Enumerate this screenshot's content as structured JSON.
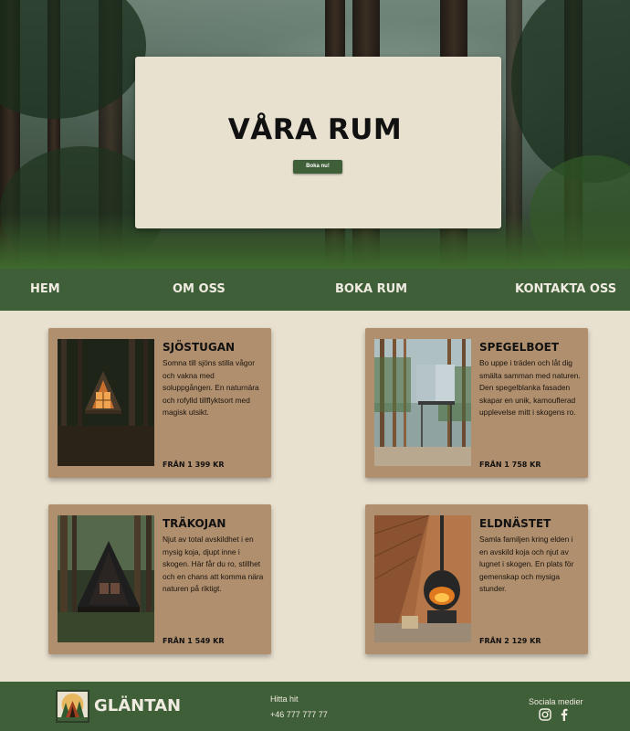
{
  "hero": {
    "title": "VÅRA RUM",
    "book_button": "Boka nu!"
  },
  "nav": {
    "items": [
      {
        "label": "HEM"
      },
      {
        "label": "OM OSS"
      },
      {
        "label": "BOKA RUM"
      },
      {
        "label": "KONTAKTA OSS"
      }
    ]
  },
  "rooms": [
    {
      "name": "SJÖSTUGAN",
      "description": "Somna till sjöns stilla vågor och vakna med soluppgången. En naturnära och rofylld tillflyktsort med magisk utsikt.",
      "price": "FRÅN 1 399 KR",
      "image": "a-frame-cabin-photo"
    },
    {
      "name": "SPEGELBOET",
      "description": "Bo uppe i träden och låt dig smälta samman med naturen. Den spegelblanka fasaden skapar en unik, kamouflerad upplevelse mitt i skogens ro.",
      "price": "FRÅN 1 758 KR",
      "image": "mirror-treehouse-photo"
    },
    {
      "name": "TRÄKOJAN",
      "description": "Njut av total avskildhet i en mysig koja, djupt inne i skogen. Här får du ro, stillhet och en chans att komma nära naturen på riktigt.",
      "price": "FRÅN 1 549 KR",
      "image": "dark-a-frame-cabin-photo"
    },
    {
      "name": "ELDNÄSTET",
      "description": "Samla familjen kring elden i en avskild koja och njut av lugnet i skogen. En plats för gemenskap och mysiga stunder.",
      "price": "FRÅN 2 129 KR",
      "image": "fireplace-interior-photo"
    }
  ],
  "footer": {
    "brand": "GLÄNTAN",
    "directions_label": "Hitta hit",
    "phone": "+46 777 777 77",
    "social_label": "Sociala medier",
    "social_icons": [
      "instagram-icon",
      "facebook-icon"
    ]
  },
  "colors": {
    "primary_green": "#3f5f38",
    "background_cream": "#e9e1d0",
    "card_brown": "#b08f6e"
  }
}
